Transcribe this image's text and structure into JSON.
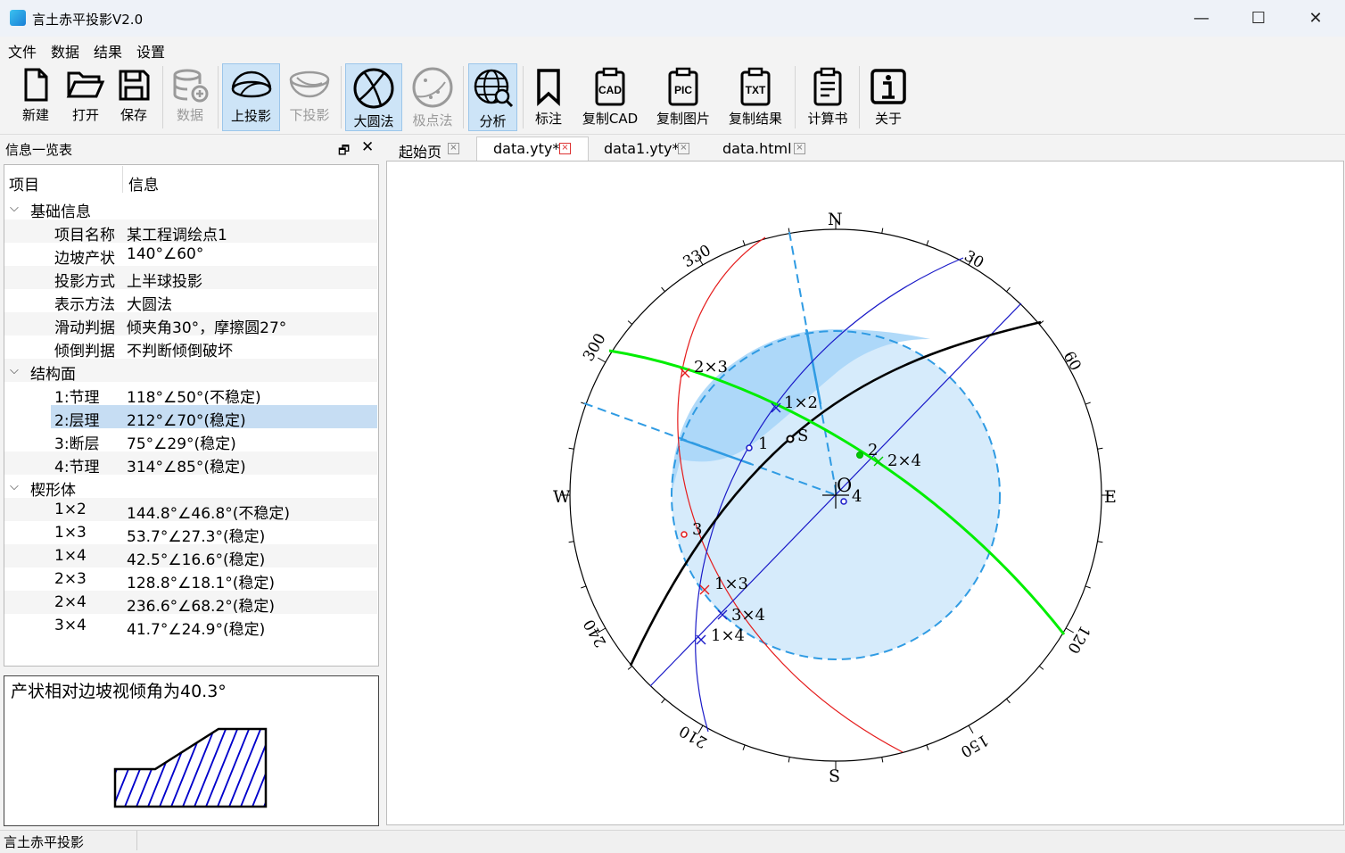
{
  "app": {
    "title": "言土赤平投影V2.0"
  },
  "menu": [
    "文件",
    "数据",
    "结果",
    "设置"
  ],
  "toolbar": {
    "new": "新建",
    "open": "打开",
    "save": "保存",
    "data": "数据",
    "upper": "上投影",
    "lower": "下投影",
    "great_circle": "大圆法",
    "pole": "极点法",
    "analyze": "分析",
    "mark": "标注",
    "copy_cad": "复制CAD",
    "copy_pic": "复制图片",
    "copy_result": "复制结果",
    "calc_book": "计算书",
    "about": "关于",
    "cad_tag": "CAD",
    "pic_tag": "PIC",
    "txt_tag": "TXT"
  },
  "panel": {
    "title": "信息一览表",
    "col_item": "项目",
    "col_info": "信息",
    "basic": {
      "title": "基础信息",
      "rows": [
        {
          "k": "项目名称",
          "v": "某工程调绘点1"
        },
        {
          "k": "边坡产状",
          "v": "140°∠60°"
        },
        {
          "k": "投影方式",
          "v": "上半球投影"
        },
        {
          "k": "表示方法",
          "v": "大圆法"
        },
        {
          "k": "滑动判据",
          "v": "倾夹角30°，摩擦圆27°"
        },
        {
          "k": "倾倒判据",
          "v": "不判断倾倒破坏"
        }
      ]
    },
    "planes": {
      "title": "结构面",
      "rows": [
        {
          "k": "1:节理",
          "v": "118°∠50°(不稳定)"
        },
        {
          "k": "2:层理",
          "v": "212°∠70°(稳定)"
        },
        {
          "k": "3:断层",
          "v": "75°∠29°(稳定)"
        },
        {
          "k": "4:节理",
          "v": "314°∠85°(稳定)"
        }
      ]
    },
    "wedges": {
      "title": "楔形体",
      "rows": [
        {
          "k": "1×2",
          "v": "144.8°∠46.8°(不稳定)"
        },
        {
          "k": "1×3",
          "v": "53.7°∠27.3°(稳定)"
        },
        {
          "k": "1×4",
          "v": "42.5°∠16.6°(稳定)"
        },
        {
          "k": "2×3",
          "v": "128.8°∠18.1°(稳定)"
        },
        {
          "k": "2×4",
          "v": "236.6°∠68.2°(稳定)"
        },
        {
          "k": "3×4",
          "v": "41.7°∠24.9°(稳定)"
        }
      ]
    },
    "preview_text": "产状相对边坡视倾角为40.3°"
  },
  "tabs": [
    {
      "label": "起始页"
    },
    {
      "label": "data.yty*"
    },
    {
      "label": "data1.yty*"
    },
    {
      "label": "data.html"
    }
  ],
  "stereonet": {
    "directions": {
      "n": "N",
      "e": "E",
      "s": "S",
      "w": "W"
    },
    "degree_labels": [
      "30",
      "60",
      "120",
      "150",
      "210",
      "240",
      "300",
      "330"
    ],
    "center": "O",
    "slope_marker": "S",
    "plane_labels": [
      "1",
      "2",
      "3",
      "4"
    ],
    "intersections": [
      "1×2",
      "2×3",
      "2×4",
      "1×3",
      "3×4",
      "1×4"
    ]
  },
  "status": "言土赤平投影"
}
